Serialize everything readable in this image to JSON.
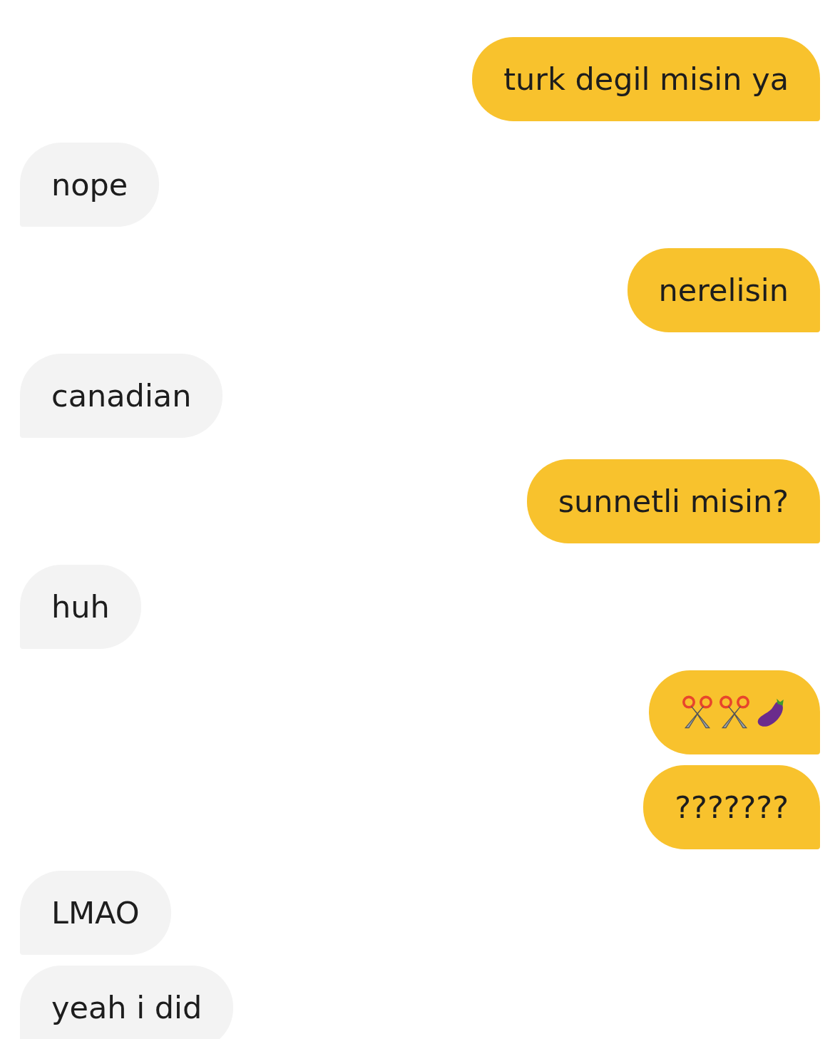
{
  "messages": [
    {
      "kind": "text",
      "outgoing": true,
      "text": "turk degil misin ya"
    },
    {
      "kind": "text",
      "outgoing": false,
      "text": "nope"
    },
    {
      "kind": "text",
      "outgoing": true,
      "text": "nerelisin"
    },
    {
      "kind": "text",
      "outgoing": false,
      "text": "canadian"
    },
    {
      "kind": "text",
      "outgoing": true,
      "text": "sunnetli misin?"
    },
    {
      "kind": "text",
      "outgoing": false,
      "text": "huh"
    },
    {
      "kind": "emoji",
      "outgoing": true
    },
    {
      "kind": "text",
      "outgoing": true,
      "text": "???????"
    },
    {
      "kind": "text",
      "outgoing": false,
      "text": "LMAO"
    },
    {
      "kind": "text",
      "outgoing": false,
      "text": "yeah i did"
    }
  ]
}
